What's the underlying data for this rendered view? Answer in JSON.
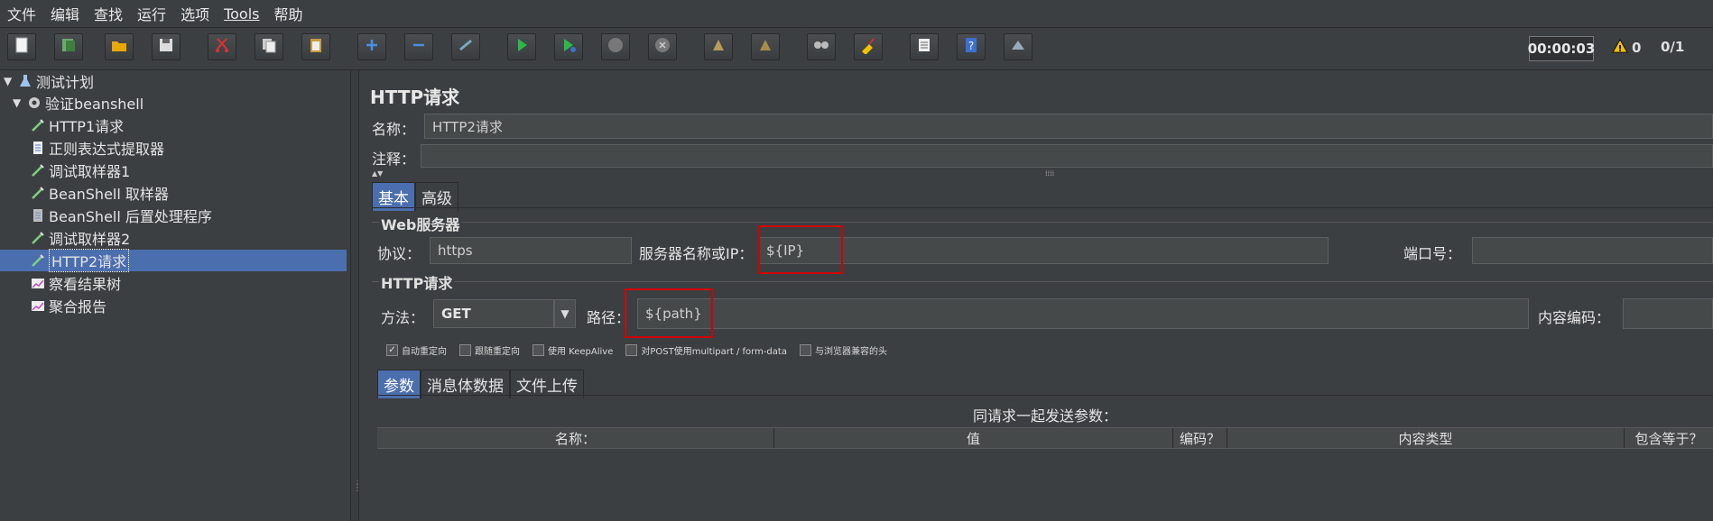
{
  "menu": [
    "文件",
    "编辑",
    "查找",
    "运行",
    "选项",
    "Tools",
    "帮助"
  ],
  "toolbar": {
    "buttons": [
      "new-icon",
      "template-icon",
      "open-icon",
      "save-icon",
      "cut-icon",
      "copy-icon",
      "paste-icon",
      "expand-icon",
      "collapse-icon",
      "toggle-icon",
      "start-icon",
      "start-no-pause-icon",
      "stop-icon",
      "shutdown-icon",
      "remote-start-icon",
      "remote-stop-icon",
      "search-icon",
      "broom-icon",
      "function-helper-icon",
      "help-icon",
      "plugin-icon"
    ],
    "timer": "00:00:03",
    "warnings": "0",
    "threads": "0/1"
  },
  "tree": [
    {
      "label": "测试计划",
      "icon": "flask-icon",
      "level": 0,
      "expanded": true
    },
    {
      "label": "验证beanshell",
      "icon": "gear-icon",
      "level": 1,
      "expanded": true
    },
    {
      "label": "HTTP1请求",
      "icon": "pipette-icon",
      "level": 2
    },
    {
      "label": "正则表达式提取器",
      "icon": "doc-icon",
      "level": 2
    },
    {
      "label": "调试取样器1",
      "icon": "pipette-icon",
      "level": 2
    },
    {
      "label": "BeanShell 取样器",
      "icon": "pipette-icon",
      "level": 2
    },
    {
      "label": "BeanShell 后置处理程序",
      "icon": "doc-icon",
      "level": 2,
      "disabled": true
    },
    {
      "label": "调试取样器2",
      "icon": "pipette-icon",
      "level": 2
    },
    {
      "label": "HTTP2请求",
      "icon": "pipette-icon",
      "level": 2,
      "selected": true
    },
    {
      "label": "察看结果树",
      "icon": "graph-icon",
      "level": 2
    },
    {
      "label": "聚合报告",
      "icon": "graph-icon",
      "level": 2
    }
  ],
  "panel": {
    "title": "HTTP请求",
    "name_label": "名称：",
    "name_value": "HTTP2请求",
    "comment_label": "注释：",
    "tabs": [
      "基本",
      "高级"
    ],
    "web_server_title": "Web服务器",
    "protocol_label": "协议：",
    "protocol_value": "https",
    "server_label": "服务器名称或IP：",
    "server_value": "${IP}",
    "port_label": "端口号：",
    "http_request_title": "HTTP请求",
    "method_label": "方法：",
    "method_value": "GET",
    "path_label": "路径：",
    "path_value": "${path}",
    "encoding_label": "内容编码：",
    "checkboxes": [
      {
        "label": "自动重定向",
        "checked": true
      },
      {
        "label": "跟随重定向",
        "checked": false
      },
      {
        "label": "使用 KeepAlive",
        "checked": false
      },
      {
        "label": "对POST使用multipart / form-data",
        "checked": false
      },
      {
        "label": "与浏览器兼容的头",
        "checked": false
      }
    ],
    "param_tabs": [
      "参数",
      "消息体数据",
      "文件上传"
    ],
    "params_caption": "同请求一起发送参数：",
    "columns": [
      "名称：",
      "值",
      "编码？",
      "内容类型",
      "包含等于？"
    ]
  },
  "colors": {
    "selection": "#4b6eaf",
    "highlight_box": "#d20000",
    "background": "#3c3f41"
  }
}
